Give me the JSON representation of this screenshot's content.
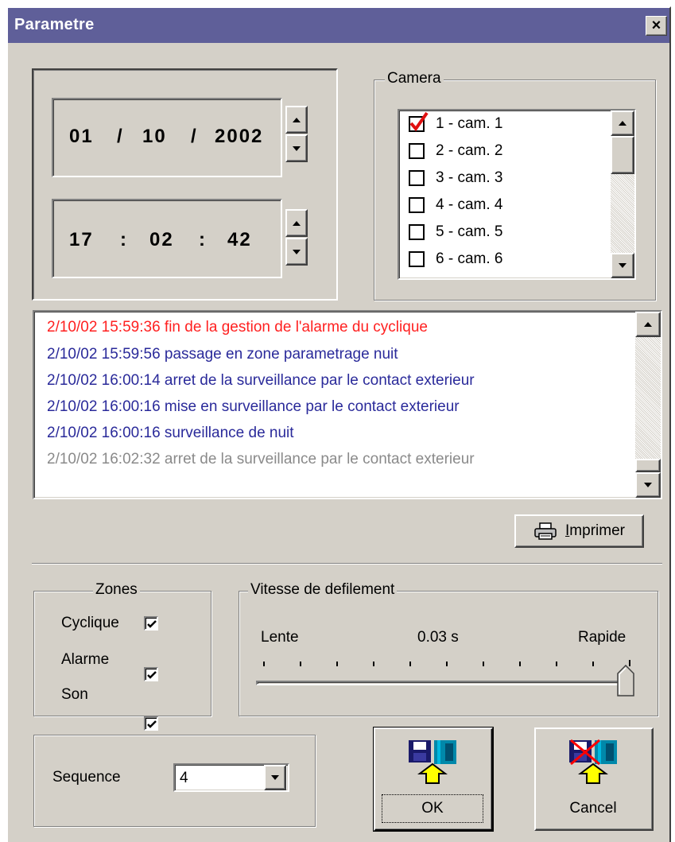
{
  "window": {
    "title": "Parametre",
    "close_symbol": "×"
  },
  "datetime": {
    "date": {
      "day": "01",
      "month": "10",
      "year": "2002",
      "sep": "/"
    },
    "time": {
      "hour": "17",
      "minute": "02",
      "second": "42",
      "sep": ":"
    }
  },
  "camera": {
    "title": "Camera",
    "items": [
      {
        "label": "1 - cam. 1",
        "checked": true
      },
      {
        "label": "2 - cam. 2",
        "checked": false
      },
      {
        "label": "3 - cam. 3",
        "checked": false
      },
      {
        "label": "4 - cam. 4",
        "checked": false
      },
      {
        "label": "5 - cam. 5",
        "checked": false
      },
      {
        "label": "6 - cam. 6",
        "checked": false
      }
    ],
    "check_color": "#e01010"
  },
  "log": {
    "lines": [
      {
        "text": "2/10/02 15:59:36 fin de la gestion de l'alarme du cyclique",
        "color": "#ff2020"
      },
      {
        "text": "2/10/02 15:59:56 passage en zone parametrage nuit",
        "color": "#2a2a9a"
      },
      {
        "text": "2/10/02 16:00:14 arret de la surveillance par le contact exterieur",
        "color": "#2a2a9a"
      },
      {
        "text": "2/10/02 16:00:16 mise en surveillance par le contact exterieur",
        "color": "#2a2a9a"
      },
      {
        "text": "2/10/02 16:00:16 surveillance de nuit",
        "color": "#2a2a9a"
      },
      {
        "text": "2/10/02 16:02:32 arret de la surveillance par le contact exterieur",
        "color": "#8a8a8a"
      }
    ]
  },
  "print_button": {
    "label": "Imprimer",
    "mnemonic": "I",
    "rest": "mprimer"
  },
  "zones": {
    "title": "Zones",
    "items": [
      {
        "label": "Cyclique",
        "checked": true
      },
      {
        "label": "Alarme",
        "checked": true
      },
      {
        "label": "Son",
        "checked": true
      }
    ]
  },
  "speed": {
    "title": "Vitesse de defilement",
    "min_label": "Lente",
    "value_label": "0.03 s",
    "max_label": "Rapide",
    "position": 1.0
  },
  "sequence": {
    "label": "Sequence",
    "value": "4"
  },
  "ok_button": {
    "label": "OK"
  },
  "cancel_button": {
    "label": "Cancel"
  }
}
